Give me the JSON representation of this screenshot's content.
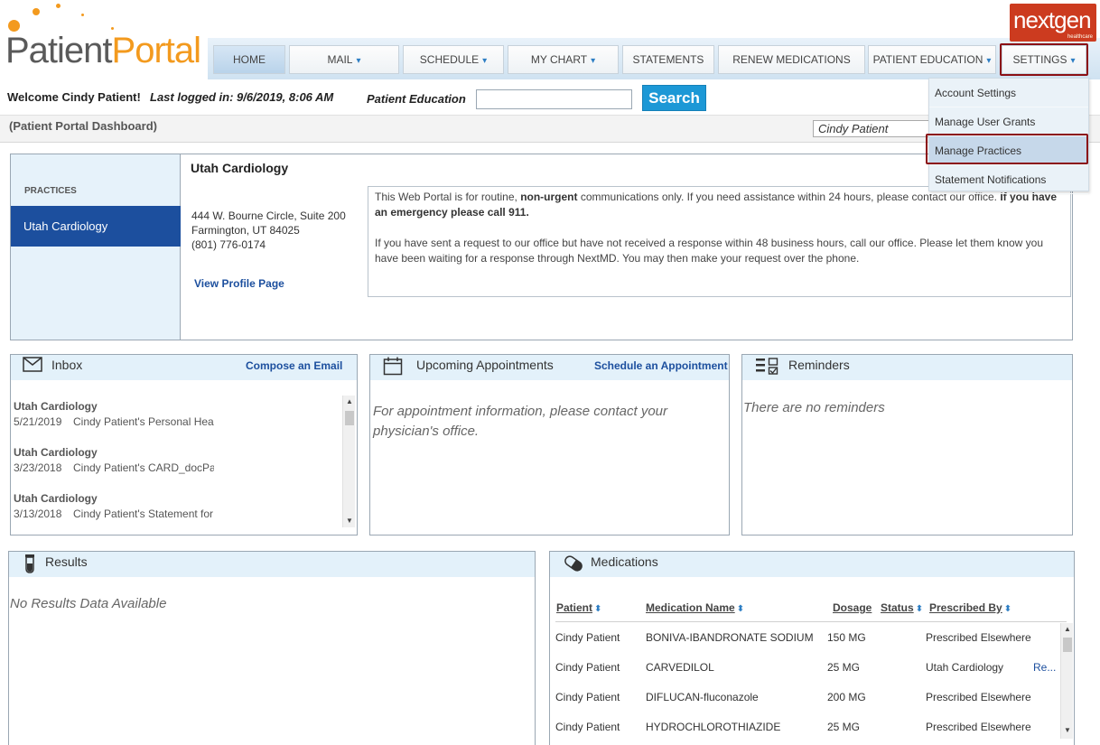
{
  "logo": {
    "patient": "Patient",
    "portal": "Portal"
  },
  "brand": {
    "name": "nextgen",
    "sub": "healthcare"
  },
  "nav": {
    "home": "HOME",
    "mail": "MAIL",
    "schedule": "SCHEDULE",
    "my_chart": "MY CHART",
    "statements": "STATEMENTS",
    "renew_medications": "RENEW MEDICATIONS",
    "patient_education": "PATIENT EDUCATION",
    "settings": "SETTINGS",
    "chevron": "▾"
  },
  "welcome": {
    "greeting": "Welcome Cindy Patient!",
    "last_login": "Last logged in: 9/6/2019, 8:06 AM",
    "patient_education_label": "Patient Education",
    "search_placeholder": "",
    "search_button": "Search"
  },
  "dashboard": {
    "title": "(Patient Portal Dashboard)",
    "patient_select": "Cindy Patient"
  },
  "settings_menu": {
    "items": [
      "Account Settings",
      "Manage User Grants",
      "Manage Practices",
      "Statement Notifications"
    ],
    "highlighted": "Manage Practices"
  },
  "practice": {
    "heading": "PRACTICES",
    "active": "Utah Cardiology",
    "name": "Utah Cardiology",
    "address1": "444 W. Bourne Circle, Suite 200",
    "address2": "Farmington, UT 84025",
    "phone": "(801) 776-0174",
    "view_profile": "View Profile Page",
    "notice": {
      "p1_a": "This Web Portal is for routine, ",
      "p1_b": "non-urgent",
      "p1_c": " communications only. If you need assistance within 24 hours, please contact our office. ",
      "p1_d": "If you have an emergency please call 911.",
      "p2": "If you have sent a request to our office but have not received a response within 48 business hours, call our office. Please let them know you have been waiting for a response through NextMD. You may then make your request over the phone."
    }
  },
  "inbox": {
    "title": "Inbox",
    "link": "Compose an Email",
    "items": [
      {
        "from": "Utah Cardiology",
        "date": "5/21/2019",
        "subject": "Cindy Patient's Personal Health"
      },
      {
        "from": "Utah Cardiology",
        "date": "3/23/2018",
        "subject": "Cindy Patient's CARD_docPatient"
      },
      {
        "from": "Utah Cardiology",
        "date": "3/13/2018",
        "subject": "Cindy Patient's Statement for C"
      }
    ]
  },
  "appointments": {
    "title": "Upcoming Appointments",
    "link": "Schedule an Appointment",
    "message": "For appointment information, please contact your physician's office."
  },
  "reminders": {
    "title": "Reminders",
    "message": "There are no reminders"
  },
  "results": {
    "title": "Results",
    "message": "No Results Data Available"
  },
  "medications": {
    "title": "Medications",
    "columns": [
      "Patient",
      "Medication Name",
      "Dosage",
      "Status",
      "Prescribed By"
    ],
    "rows": [
      {
        "patient": "Cindy Patient",
        "name": "BONIVA-IBANDRONATE SODIUM",
        "dosage": "150 MG",
        "status": "",
        "prescribed_by": "Prescribed Elsewhere",
        "action": ""
      },
      {
        "patient": "Cindy Patient",
        "name": "CARVEDILOL",
        "dosage": "25 MG",
        "status": "",
        "prescribed_by": "Utah Cardiology",
        "action": "Re..."
      },
      {
        "patient": "Cindy Patient",
        "name": "DIFLUCAN-fluconazole",
        "dosage": "200 MG",
        "status": "",
        "prescribed_by": "Prescribed Elsewhere",
        "action": ""
      },
      {
        "patient": "Cindy Patient",
        "name": "HYDROCHLOROTHIAZIDE",
        "dosage": "25 MG",
        "status": "",
        "prescribed_by": "Prescribed Elsewhere",
        "action": ""
      }
    ]
  },
  "colors": {
    "accent_orange": "#f39a1e",
    "nav_blue": "#1c4f9e",
    "search_blue": "#1c98d6",
    "highlight_red": "#8b0f14",
    "brand_red": "#cc3b1f"
  }
}
